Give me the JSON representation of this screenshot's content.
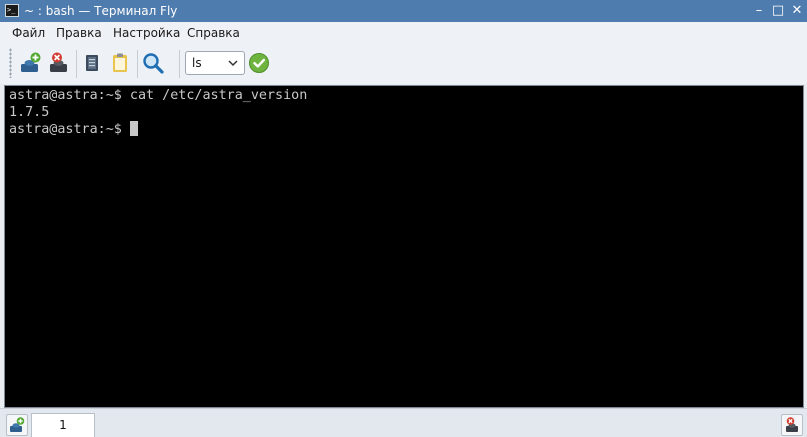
{
  "window": {
    "title": "~ : bash — Терминал Fly",
    "app_icon_text": ">_",
    "controls": {
      "minimize": "–",
      "maximize": "□",
      "close": "✕"
    },
    "titlebar_color": "#4f7cae"
  },
  "menu": {
    "items": [
      {
        "label": "Файл"
      },
      {
        "label": "Правка"
      },
      {
        "label": "Настройка"
      },
      {
        "label": "Справка"
      }
    ]
  },
  "toolbar": {
    "buttons": [
      {
        "icon": "new-session-icon"
      },
      {
        "icon": "close-session-icon"
      },
      {
        "icon": "copy-icon"
      },
      {
        "icon": "paste-icon"
      },
      {
        "icon": "search-icon"
      }
    ],
    "command_select": {
      "value": "ls"
    },
    "run_button": {
      "icon": "check-icon",
      "color": "#6fb43f"
    }
  },
  "terminal": {
    "lines": [
      "astra@astra:~$ cat /etc/astra_version",
      "1.7.5",
      "astra@astra:~$ "
    ],
    "background": "#000000",
    "foreground": "#c8c8c8"
  },
  "tabs": {
    "items": [
      {
        "label": "1",
        "active": true
      }
    ],
    "new_tab_icon": "new-tab-icon",
    "close_tab_icon": "close-tab-icon"
  }
}
